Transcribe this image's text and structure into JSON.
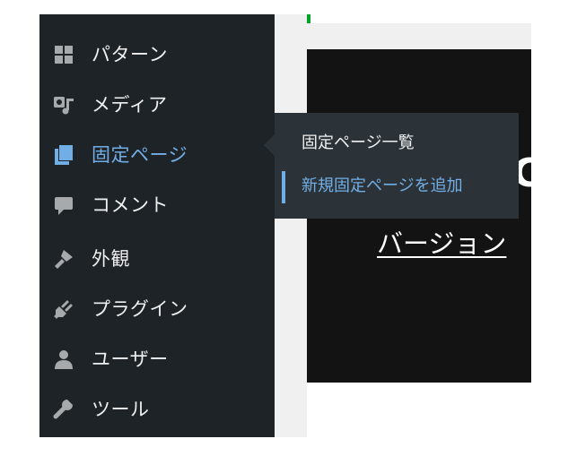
{
  "colors": {
    "sidebar_bg": "#1d2327",
    "flyout_bg": "#2c3338",
    "menu_text": "#f0f0f1",
    "accent": "#72aee6",
    "icon_gray": "#a7aaad",
    "preview_bg": "#131313",
    "green_mark": "#00a32a"
  },
  "sidebar": {
    "items": [
      {
        "label": "パターン",
        "icon": "grid-icon"
      },
      {
        "label": "メディア",
        "icon": "media-icon"
      },
      {
        "label": "固定ページ",
        "icon": "page-icon",
        "active": true
      },
      {
        "label": "コメント",
        "icon": "comment-icon"
      },
      {
        "label": "外観",
        "icon": "brush-icon"
      },
      {
        "label": "プラグイン",
        "icon": "plugin-icon"
      },
      {
        "label": "ユーザー",
        "icon": "user-icon"
      },
      {
        "label": "ツール",
        "icon": "wrench-icon"
      }
    ]
  },
  "flyout": {
    "items": [
      {
        "label": "固定ページ一覧"
      },
      {
        "label": "新規固定ページを追加",
        "current": true
      }
    ]
  },
  "preview": {
    "heading_fragment": "C",
    "link_text": "バージョン"
  }
}
